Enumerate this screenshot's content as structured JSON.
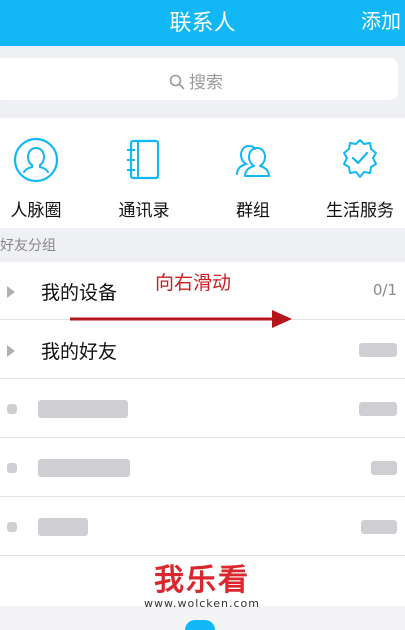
{
  "header": {
    "title": "联系人",
    "add_label": "添加"
  },
  "search": {
    "placeholder": "搜索"
  },
  "shortcuts": [
    {
      "label": "人脉圈",
      "icon": "person-circle-icon"
    },
    {
      "label": "通讯录",
      "icon": "address-book-icon"
    },
    {
      "label": "群组",
      "icon": "group-icon"
    },
    {
      "label": "生活服务",
      "icon": "verified-shield-icon"
    }
  ],
  "section": {
    "title": "好友分组"
  },
  "groups": [
    {
      "name": "我的设备",
      "count": "0/1"
    },
    {
      "name": "我的好友"
    }
  ],
  "annotation": {
    "text": "向右滑动"
  },
  "watermark": {
    "brand": "我乐看",
    "url": "www.wolcken.com"
  },
  "colors": {
    "accent": "#12b7f5",
    "annotation": "#cc1f24",
    "watermark": "#d9272d"
  }
}
